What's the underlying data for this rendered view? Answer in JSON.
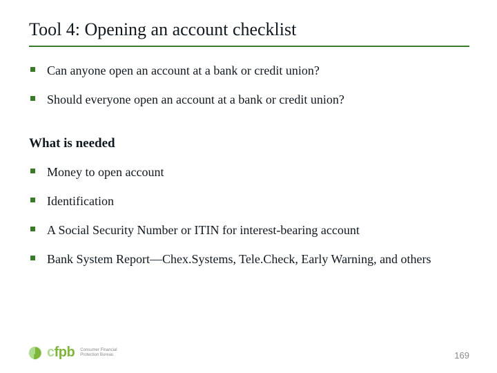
{
  "title": "Tool 4: Opening an account checklist",
  "questions": [
    "Can anyone open an account at a bank or credit union?",
    "Should everyone open an account at a bank or credit union?"
  ],
  "subhead": "What is needed",
  "needed": [
    "Money to open account",
    "Identification",
    "A Social Security Number or ITIN for interest-bearing account",
    "Bank System Report—Chex.Systems,  Tele.Check, Early Warning, and others"
  ],
  "logo": {
    "abbr_c": "c",
    "abbr_rest": "fpb",
    "name_line1": "Consumer Financial",
    "name_line2": "Protection Bureau"
  },
  "page_number": "169",
  "colors": {
    "accent": "#3a7b2a",
    "logo_green": "#7fb539",
    "logo_light": "#addc91"
  }
}
